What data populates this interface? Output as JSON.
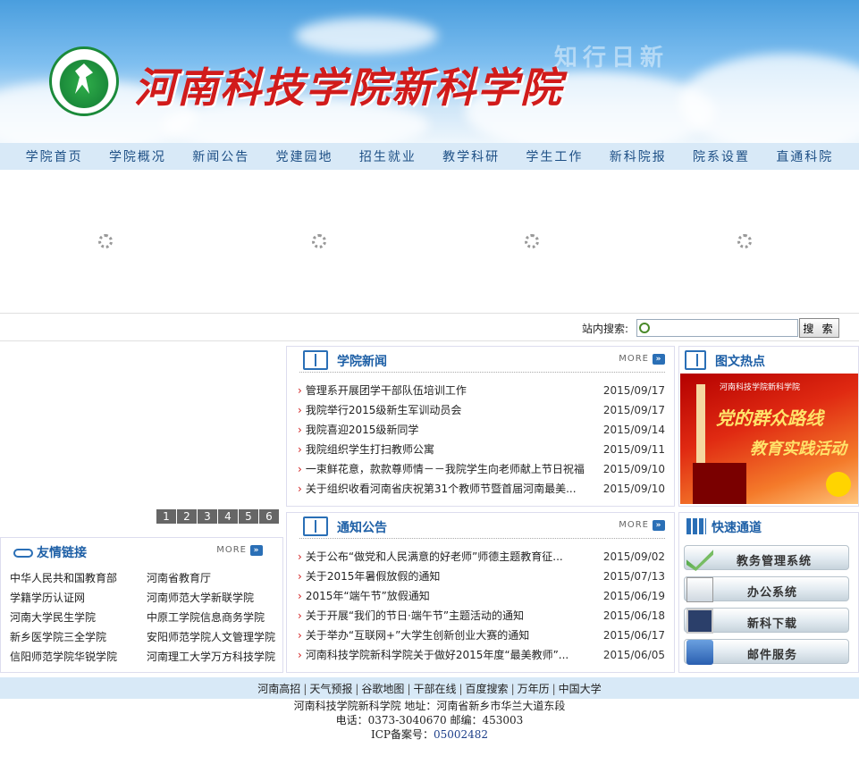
{
  "header": {
    "school_name": "河南科技学院新科学院",
    "motto": "知行日新",
    "emblem_text": "河南科技学院新科学院"
  },
  "nav": [
    "学院首页",
    "学院概况",
    "新闻公告",
    "党建园地",
    "招生就业",
    "教学科研",
    "学生工作",
    "新科院报",
    "院系设置",
    "直通科院"
  ],
  "search": {
    "label": "站内搜索:",
    "placeholder": "",
    "button": "搜 索"
  },
  "pager": [
    "1",
    "2",
    "3",
    "4",
    "5",
    "6"
  ],
  "college_news": {
    "title": "学院新闻",
    "more": "MORE",
    "items": [
      {
        "title": "管理系开展团学干部队伍培训工作",
        "date": "2015/09/17"
      },
      {
        "title": "我院举行2015级新生军训动员会",
        "date": "2015/09/17"
      },
      {
        "title": "我院喜迎2015级新同学",
        "date": "2015/09/14"
      },
      {
        "title": "我院组织学生打扫教师公寓",
        "date": "2015/09/11"
      },
      {
        "title": "一束鲜花意，款款尊师情－－我院学生向老师献上节日祝福",
        "date": "2015/09/10"
      },
      {
        "title": "关于组织收看河南省庆祝第31个教师节暨首届河南最美...",
        "date": "2015/09/10"
      }
    ]
  },
  "notices": {
    "title": "通知公告",
    "more": "MORE",
    "items": [
      {
        "title": "关于公布“做党和人民满意的好老师”师德主题教育征...",
        "date": "2015/09/02"
      },
      {
        "title": "关于2015年暑假放假的通知",
        "date": "2015/07/13"
      },
      {
        "title": "2015年“端午节”放假通知",
        "date": "2015/06/19"
      },
      {
        "title": "关于开展“我们的节日·端午节”主题活动的通知",
        "date": "2015/06/18"
      },
      {
        "title": "关于举办“互联网+”大学生创新创业大赛的通知",
        "date": "2015/06/17"
      },
      {
        "title": "河南科技学院新科学院关于做好2015年度“最美教师”...",
        "date": "2015/06/05"
      }
    ]
  },
  "friend_links": {
    "title": "友情链接",
    "more": "MORE",
    "items": [
      "中华人民共和国教育部",
      "河南省教育厅",
      "学籍学历认证网",
      "河南师范大学新联学院",
      "河南大学民生学院",
      "中原工学院信息商务学院",
      "新乡医学院三全学院",
      "安阳师范学院人文管理学院",
      "信阳师范学院华锐学院",
      "河南理工大学万方科技学院"
    ]
  },
  "hot_pics": {
    "title": "图文热点",
    "image_caption": "河南科技学院新科学院",
    "image_line1": "党的群众路线",
    "image_line2": "教育实践活动"
  },
  "quick_access": {
    "title": "快速通道",
    "items": [
      "教务管理系统",
      "办公系统",
      "新科下载",
      "邮件服务"
    ]
  },
  "footer": {
    "links": [
      "河南高招",
      "天气预报",
      "谷歌地图",
      "干部在线",
      "百度搜索",
      "万年历",
      "中国大学"
    ],
    "address": "河南科技学院新科学院  地址：河南省新乡市华兰大道东段",
    "contact": "电话：0373-3040670  邮编：453003",
    "icp_label": "ICP备案号：",
    "icp_number": "05002482"
  },
  "colors": {
    "nav_bg": "#d8e9f7",
    "title_blue": "#1d5fa6",
    "logo_red": "#d11b1b",
    "emblem_green": "#1b8a3a"
  }
}
